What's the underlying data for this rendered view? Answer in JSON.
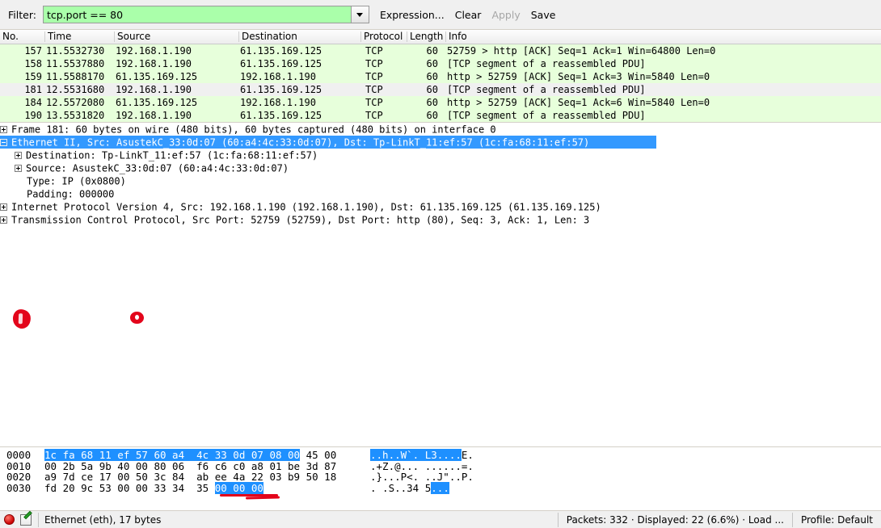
{
  "filter_bar": {
    "label": "Filter:",
    "value": "tcp.port == 80",
    "placeholder": "",
    "dropdown_icon": "chevron-down-icon",
    "buttons": [
      {
        "label": "Expression...",
        "enabled": true
      },
      {
        "label": "Clear",
        "enabled": true
      },
      {
        "label": "Apply",
        "enabled": false
      },
      {
        "label": "Save",
        "enabled": true
      }
    ]
  },
  "packet_list": {
    "columns": [
      "No.",
      "Time",
      "Source",
      "Destination",
      "Protocol",
      "Length",
      "Info"
    ],
    "rows": [
      {
        "no": "157",
        "time": "11.5532730",
        "source": "192.168.1.190",
        "destination": "61.135.169.125",
        "protocol": "TCP",
        "length": "60",
        "info": "52759 > http [ACK] Seq=1 Ack=1 Win=64800 Len=0",
        "style": "green",
        "selected": false
      },
      {
        "no": "158",
        "time": "11.5537880",
        "source": "192.168.1.190",
        "destination": "61.135.169.125",
        "protocol": "TCP",
        "length": "60",
        "info": "[TCP segment of a reassembled PDU]",
        "style": "green",
        "selected": false
      },
      {
        "no": "159",
        "time": "11.5588170",
        "source": "61.135.169.125",
        "destination": "192.168.1.190",
        "protocol": "TCP",
        "length": "60",
        "info": "http > 52759 [ACK] Seq=1 Ack=3 Win=5840 Len=0",
        "style": "green",
        "selected": false
      },
      {
        "no": "181",
        "time": "12.5531680",
        "source": "192.168.1.190",
        "destination": "61.135.169.125",
        "protocol": "TCP",
        "length": "60",
        "info": "[TCP segment of a reassembled PDU]",
        "style": "grey",
        "selected": true
      },
      {
        "no": "184",
        "time": "12.5572080",
        "source": "61.135.169.125",
        "destination": "192.168.1.190",
        "protocol": "TCP",
        "length": "60",
        "info": "http > 52759 [ACK] Seq=1 Ack=6 Win=5840 Len=0",
        "style": "green",
        "selected": false
      },
      {
        "no": "190",
        "time": "13.5531820",
        "source": "192.168.1.190",
        "destination": "61.135.169.125",
        "protocol": "TCP",
        "length": "60",
        "info": "[TCP segment of a reassembled PDU]",
        "style": "green",
        "selected": false
      }
    ]
  },
  "packet_detail": {
    "rows": [
      {
        "text": "Frame 181: 60 bytes on wire (480 bits), 60 bytes captured (480 bits) on interface 0",
        "expander": "plus",
        "indent": 0,
        "selected": false
      },
      {
        "text": "Ethernet II, Src: AsustekC_33:0d:07 (60:a4:4c:33:0d:07), Dst: Tp-LinkT_11:ef:57 (1c:fa:68:11:ef:57)",
        "expander": "minus",
        "indent": 0,
        "selected": true
      },
      {
        "text": "Destination: Tp-LinkT_11:ef:57 (1c:fa:68:11:ef:57)",
        "expander": "plus",
        "indent": 1,
        "selected": false
      },
      {
        "text": "Source: AsustekC_33:0d:07 (60:a4:4c:33:0d:07)",
        "expander": "plus",
        "indent": 1,
        "selected": false
      },
      {
        "text": "Type: IP (0x0800)",
        "expander": "none",
        "indent": 1,
        "selected": false
      },
      {
        "text": "Padding: 000000",
        "expander": "none",
        "indent": 1,
        "selected": false
      },
      {
        "text": "Internet Protocol Version 4, Src: 192.168.1.190 (192.168.1.190), Dst: 61.135.169.125 (61.135.169.125)",
        "expander": "plus",
        "indent": 0,
        "selected": false
      },
      {
        "text": "Transmission Control Protocol, Src Port: 52759 (52759), Dst Port: http (80), Seq: 3, Ack: 1, Len: 3",
        "expander": "plus",
        "indent": 0,
        "selected": false
      }
    ]
  },
  "hex_pane": {
    "rows": [
      {
        "offset": "0000",
        "bytes_hl": "1c fa 68 11 ef 57 60 a4  4c 33 0d 07 08 00",
        "bytes_tail": " 45 00",
        "ascii_hl": "..h..W`. L3....",
        "ascii_tail": "E."
      },
      {
        "offset": "0010",
        "bytes_hl": "",
        "bytes_tail": "00 2b 5a 9b 40 00 80 06  f6 c6 c0 a8 01 be 3d 87",
        "ascii_hl": "",
        "ascii_tail": ".+Z.@... ......=."
      },
      {
        "offset": "0020",
        "bytes_hl": "",
        "bytes_tail": "a9 7d ce 17 00 50 3c 84  ab ee 4a 22 03 b9 50 18",
        "ascii_hl": "",
        "ascii_tail": ".}...P<. ..J\"..P."
      },
      {
        "offset": "0030",
        "bytes_pre": "fd 20 9c 53 00 00 33 34  35 ",
        "bytes_hl": "00 00 00",
        "bytes_tail": "",
        "ascii_pre": ". .S..34 5",
        "ascii_hl": "...",
        "ascii_tail": ""
      }
    ]
  },
  "annotations": {
    "left_blob": "red-pen-mark",
    "dot": "red-dot-mark",
    "underline": "red-underline-mark",
    "color": "#e3051b"
  },
  "status_bar": {
    "capture_icon": "record-circle-icon",
    "edit_icon": "capture-comment-icon",
    "interface_text": "Ethernet (eth), 17 bytes",
    "packets_text": "Packets: 332 · Displayed: 22 (6.6%) · Load ...",
    "profile_text": "Profile: Default"
  }
}
